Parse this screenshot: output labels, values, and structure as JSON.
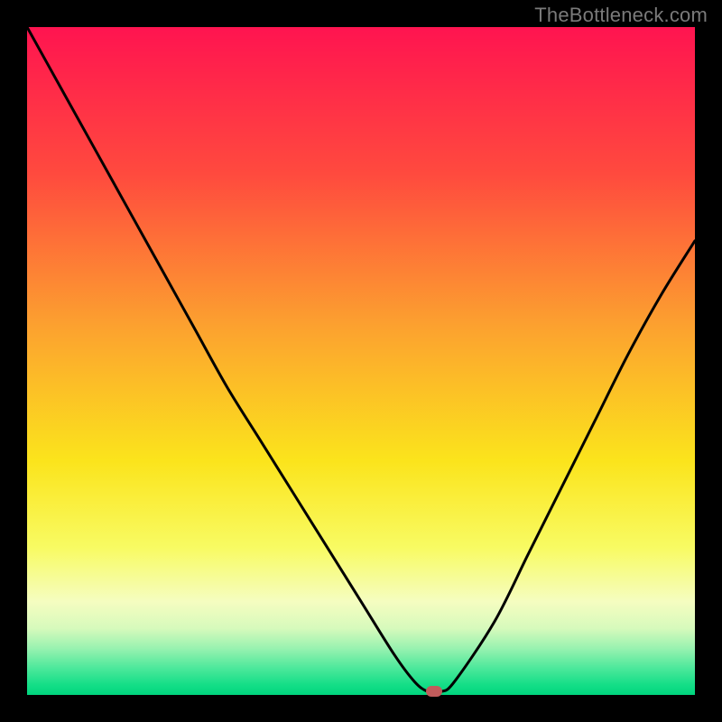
{
  "watermark": "TheBottleneck.com",
  "chart_data": {
    "type": "line",
    "title": "",
    "xlabel": "",
    "ylabel": "",
    "xlim": [
      0,
      100
    ],
    "ylim": [
      0,
      100
    ],
    "x": [
      0,
      5,
      10,
      15,
      20,
      25,
      30,
      35,
      40,
      45,
      50,
      55,
      58,
      60,
      62,
      64,
      70,
      75,
      80,
      85,
      90,
      95,
      100
    ],
    "values": [
      100,
      91,
      82,
      73,
      64,
      55,
      46,
      38,
      30,
      22,
      14,
      6,
      2,
      0.5,
      0.5,
      2,
      11,
      21,
      31,
      41,
      51,
      60,
      68
    ],
    "marker": {
      "x": 61,
      "y": 0.5
    },
    "gradient_stops": [
      {
        "offset": 0.0,
        "color": "#FF1450"
      },
      {
        "offset": 0.22,
        "color": "#FF4A3E"
      },
      {
        "offset": 0.45,
        "color": "#FCA22F"
      },
      {
        "offset": 0.65,
        "color": "#FBE41C"
      },
      {
        "offset": 0.78,
        "color": "#F8FB63"
      },
      {
        "offset": 0.86,
        "color": "#F5FDC0"
      },
      {
        "offset": 0.9,
        "color": "#D7FABC"
      },
      {
        "offset": 0.93,
        "color": "#99F2B0"
      },
      {
        "offset": 0.96,
        "color": "#4CE89B"
      },
      {
        "offset": 0.985,
        "color": "#14DE87"
      },
      {
        "offset": 1.0,
        "color": "#00D57E"
      }
    ],
    "line_color": "#000000",
    "line_width": 3
  }
}
